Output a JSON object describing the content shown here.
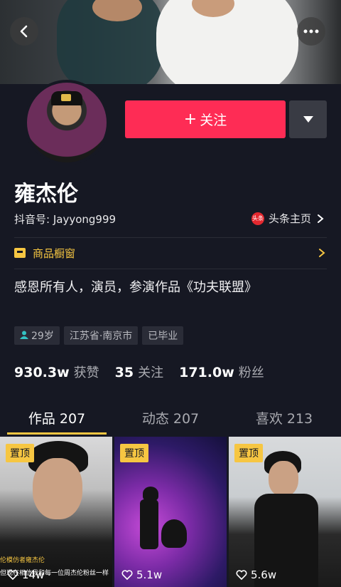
{
  "header": {
    "back_icon": "chevron-left-icon",
    "more_icon": "more-dots-icon"
  },
  "profile": {
    "name": "雍杰伦",
    "douyin_id": "抖音号: Jayyong999",
    "follow_label": "关注",
    "toutiao_badge": "头条",
    "toutiao_label": "头条主页",
    "shop_label": "商品橱窗",
    "bio": "感恩所有人，演员，参演作品《功夫联盟》",
    "tags": [
      "29岁",
      "江苏省·南京市",
      "已毕业"
    ],
    "stats": [
      {
        "num": "930.3w",
        "label": "获赞"
      },
      {
        "num": "35",
        "label": "关注"
      },
      {
        "num": "171.0w",
        "label": "粉丝"
      }
    ]
  },
  "tabs": [
    {
      "label": "作品 207",
      "active": true
    },
    {
      "label": "动态 207",
      "active": false
    },
    {
      "label": "喜欢 213",
      "active": false
    }
  ],
  "videos": [
    {
      "pin": "置顶",
      "likes": "14w",
      "caption": "伦模仿者雍杰伦",
      "caption2": "但现在相信我和每一位周杰伦粉丝一样"
    },
    {
      "pin": "置顶",
      "likes": "5.1w"
    },
    {
      "pin": "置顶",
      "likes": "5.6w"
    }
  ],
  "colors": {
    "background": "#161823",
    "follow": "#fe2c55",
    "accent": "#f6c642"
  }
}
